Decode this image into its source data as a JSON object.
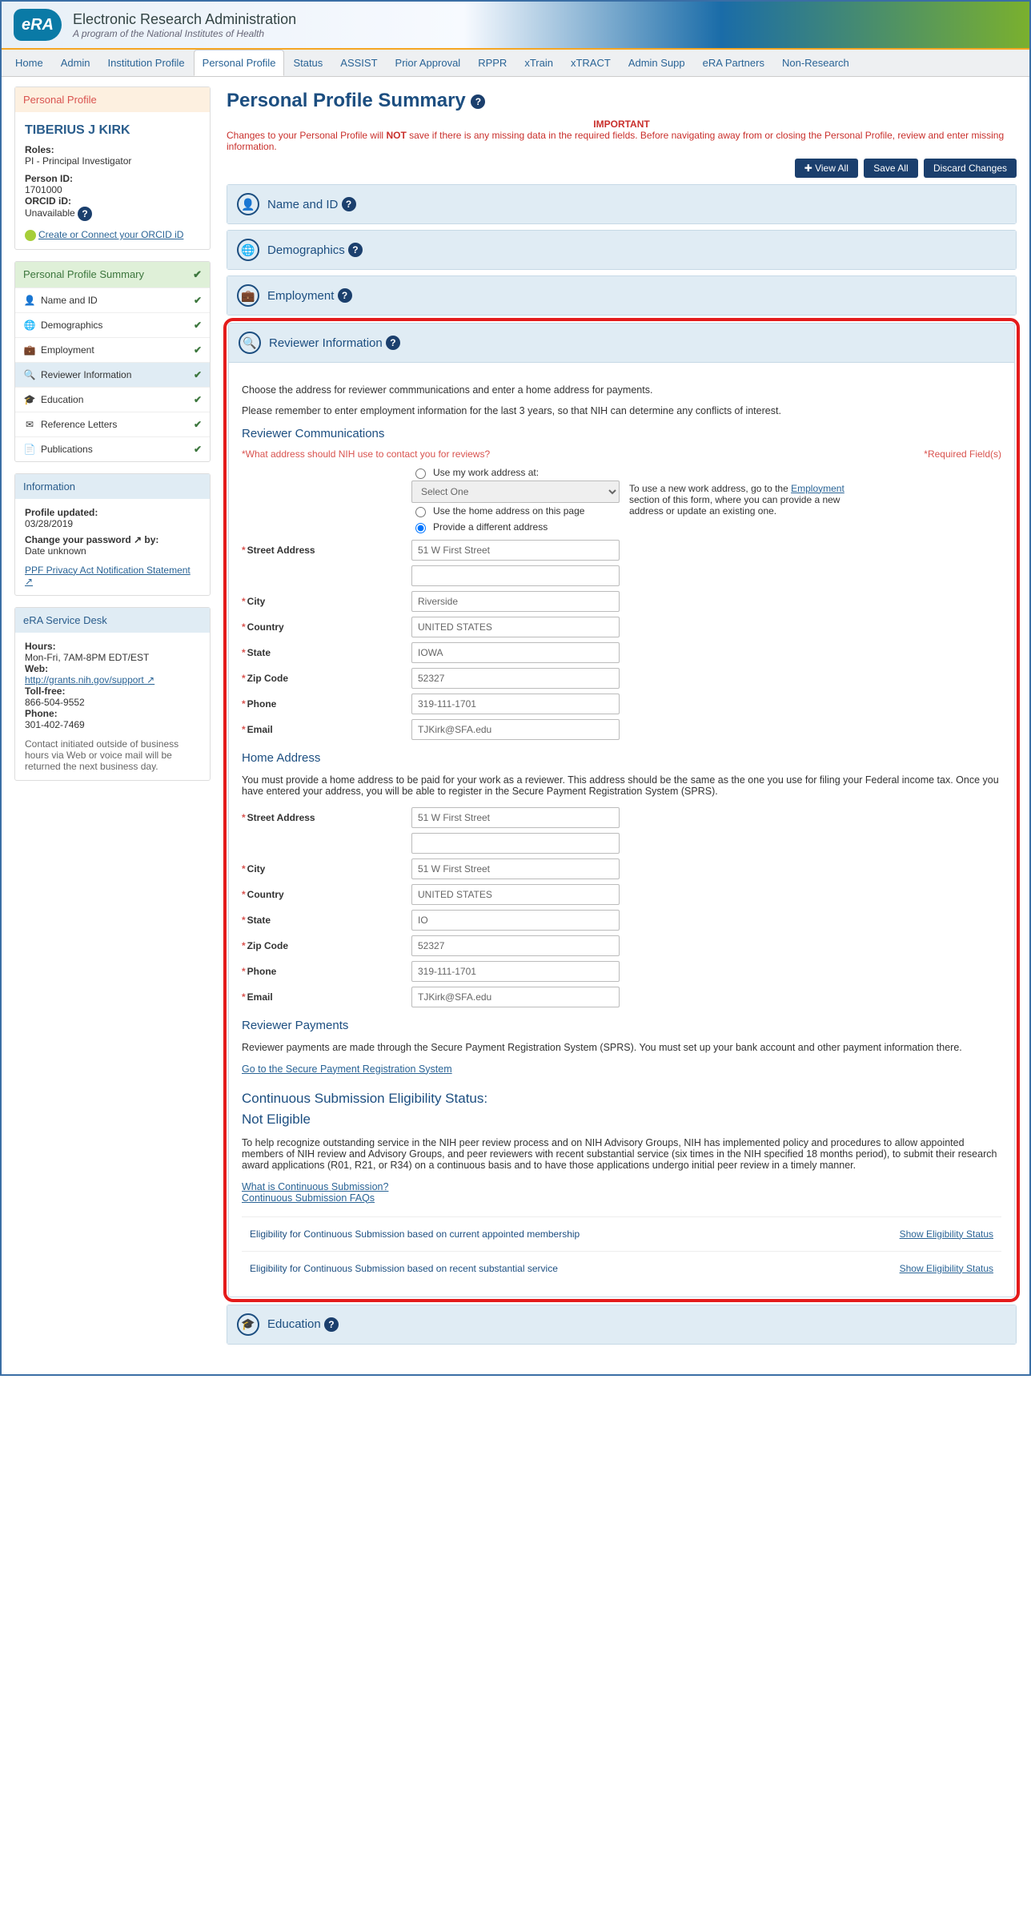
{
  "banner": {
    "logo": "eRA",
    "title": "Electronic Research Administration",
    "subtitle": "A program of the National Institutes of Health"
  },
  "nav": {
    "items": [
      "Home",
      "Admin",
      "Institution Profile",
      "Personal Profile",
      "Status",
      "ASSIST",
      "Prior Approval",
      "RPPR",
      "xTrain",
      "xTRACT",
      "Admin Supp",
      "eRA Partners",
      "Non-Research"
    ],
    "active": "Personal Profile"
  },
  "profile": {
    "card_title": "Personal Profile",
    "name": "TIBERIUS J KIRK",
    "roles_label": "Roles:",
    "roles": "PI - Principal Investigator",
    "person_id_label": "Person ID:",
    "person_id": "1701000",
    "orcid_label": "ORCID iD:",
    "orcid": "Unavailable",
    "orcid_link": "Create or Connect your ORCID iD"
  },
  "sections_nav": {
    "title": "Personal Profile Summary",
    "items": [
      {
        "icon": "👤",
        "label": "Name and ID"
      },
      {
        "icon": "🌐",
        "label": "Demographics"
      },
      {
        "icon": "💼",
        "label": "Employment"
      },
      {
        "icon": "🔍",
        "label": "Reviewer Information",
        "active": true
      },
      {
        "icon": "🎓",
        "label": "Education"
      },
      {
        "icon": "✉",
        "label": "Reference Letters"
      },
      {
        "icon": "📄",
        "label": "Publications"
      }
    ]
  },
  "info": {
    "title": "Information",
    "updated_label": "Profile updated:",
    "updated": "03/28/2019",
    "changepw_label": "Change your password ↗ by:",
    "changepw": "Date unknown",
    "privacy": "PPF Privacy Act Notification Statement ↗"
  },
  "service": {
    "title": "eRA Service Desk",
    "hours_label": "Hours:",
    "hours": "Mon-Fri, 7AM-8PM EDT/EST",
    "web_label": "Web:",
    "web": "http://grants.nih.gov/support ↗",
    "tollfree_label": "Toll-free:",
    "tollfree": "866-504-9552",
    "phone_label": "Phone:",
    "phone": "301-402-7469",
    "note": "Contact initiated outside of business hours via Web or voice mail will be returned the next business day."
  },
  "main": {
    "title": "Personal Profile Summary",
    "important": "IMPORTANT",
    "note_pre": "Changes to your Personal Profile will ",
    "note_bold": "NOT",
    "note_post": " save if there is any missing data in the required fields. Before navigating away from or closing the Personal Profile, review and enter missing information.",
    "buttons": {
      "view": "✚ View All",
      "save": "Save All",
      "discard": "Discard Changes"
    },
    "accordions": {
      "name": "Name and ID",
      "demo": "Demographics",
      "emp": "Employment",
      "rev": "Reviewer Information",
      "edu": "Education"
    }
  },
  "reviewer": {
    "intro1": "Choose the address for reviewer commmunications and enter a home address for payments.",
    "intro2": "Please remember to enter employment information for the last 3 years, so that NIH can determine any conflicts of interest.",
    "comm_title": "Reviewer Communications",
    "req_note": "*Required Field(s)",
    "question": "*What address should NIH use to contact you for reviews?",
    "opt1": "Use my work address at:",
    "select_placeholder": "Select One",
    "opt2": "Use the home address on this page",
    "opt3": "Provide a different address",
    "help": "To use a new work address, go to the ",
    "help_link": "Employment",
    "help2": " section of this form, where you can provide a new address or update an existing one.",
    "labels": {
      "street": "Street Address",
      "city": "City",
      "country": "Country",
      "state": "State",
      "zip": "Zip Code",
      "phone": "Phone",
      "email": "Email"
    },
    "comm": {
      "street": "51 W First Street",
      "street2": "",
      "city": "Riverside",
      "country": "UNITED STATES",
      "state": "IOWA",
      "zip": "52327",
      "phone": "319-111-1701",
      "email": "TJKirk@SFA.edu"
    },
    "home_title": "Home Address",
    "home_intro": "You must provide a home address to be paid for your work as a reviewer. This address should be the same as the one you use for filing your Federal income tax. Once you have entered your address, you will be able to register in the Secure Payment Registration System (SPRS).",
    "home": {
      "street": "51 W First Street",
      "street2": "",
      "city": "51 W First Street",
      "country": "UNITED STATES",
      "state": "IO",
      "zip": "52327",
      "phone": "319-111-1701",
      "email": "TJKirk@SFA.edu"
    },
    "pay_title": "Reviewer Payments",
    "pay_intro": "Reviewer payments are made through the Secure Payment Registration System (SPRS). You must set up your bank account and other payment information there.",
    "pay_link": "Go to the Secure Payment Registration System",
    "cs_title": "Continuous Submission Eligibility Status:",
    "cs_status": "Not Eligible",
    "cs_para": "To help recognize outstanding service in the NIH peer review process and on NIH Advisory Groups, NIH has implemented policy and procedures to allow appointed members of NIH review and Advisory Groups, and peer reviewers with recent substantial service (six times in the NIH specified 18 months period), to submit their research award applications (R01, R21, or R34) on a continuous basis and to have those applications undergo initial peer review in a timely manner.",
    "cs_link1": "What is Continuous Submission?",
    "cs_link2": "Continuous Submission FAQs",
    "elig1": "Eligibility for Continuous Submission based on current appointed membership",
    "elig2": "Eligibility for Continuous Submission based on recent substantial service",
    "show": "Show Eligibility Status"
  }
}
